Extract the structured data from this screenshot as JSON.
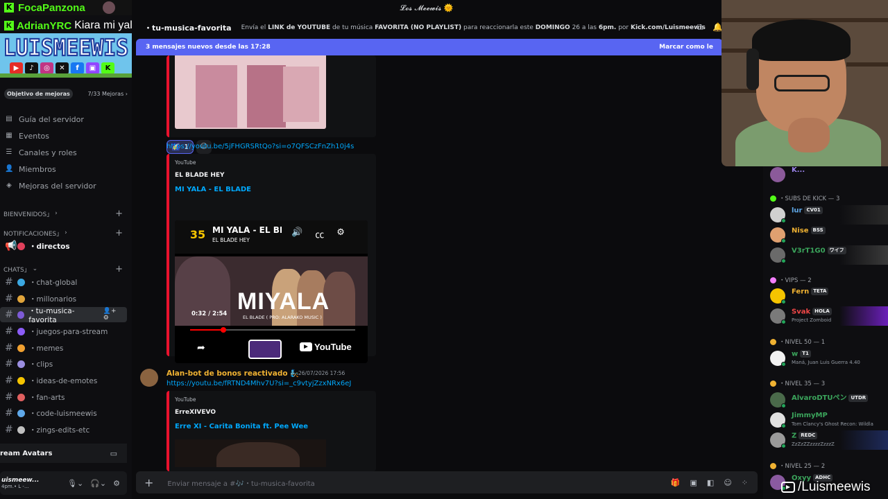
{
  "window": {
    "title": "𝓛𝓸𝓼 𝓜𝓮𝓮𝔀𝓲𝓼 🌞"
  },
  "overlay": {
    "kick_user": "FocaPanzona",
    "chat_user": "AdrianYRC",
    "chat_message": "Kiara mi yala",
    "banner_title": "LUISMEEWIS",
    "watermark": "/Luismeewis"
  },
  "server": {
    "boost_label": "Objetivo de mejoras",
    "boost_count": "7/33 Mejoras ›",
    "nav": [
      {
        "label": "Guía del servidor",
        "icon": "guide-icon"
      },
      {
        "label": "Eventos",
        "icon": "calendar-icon"
      },
      {
        "label": "Canales y roles",
        "icon": "channels-icon"
      },
      {
        "label": "Miembros",
        "icon": "members-icon"
      },
      {
        "label": "Mejoras del servidor",
        "icon": "boost-icon"
      }
    ],
    "categories": {
      "bienvenidos": "BIENVENIDOS」",
      "notificaciones": "NOTIFICACIONES」",
      "chats": "CHATS」"
    },
    "announce_channel": "・directos",
    "channels": [
      {
        "name": "・chat-global",
        "color": "#3ba7e0"
      },
      {
        "name": "・millonarios",
        "color": "#e0a43b"
      },
      {
        "name": "・tu-musica-favorita",
        "color": "#7d5bd6"
      },
      {
        "name": "・juegos-para-stream",
        "color": "#8b5cf6"
      },
      {
        "name": "・memes",
        "color": "#f0a030"
      },
      {
        "name": "・clips",
        "color": "#9b8ee0"
      },
      {
        "name": "・ideas-de-emotes",
        "color": "#f5c400"
      },
      {
        "name": "・fan-arts",
        "color": "#e06060"
      },
      {
        "name": "・code-luismeewis",
        "color": "#5fa8e8"
      },
      {
        "name": "・zings-edits-etc",
        "color": "#c0c0c0"
      }
    ],
    "voice_channel": "ream Avatars",
    "user_name": "uismeew...",
    "user_status": "4pm.• L -..."
  },
  "header": {
    "channel": "・tu-musica-favorita",
    "topic_pre": "Envía el ",
    "topic_b1": "LINK de YOUTUBE",
    "topic_mid1": " de tu música ",
    "topic_b2": "FAVORITA (NO PLAYLIST)",
    "topic_mid2": " para reaccionarla este ",
    "topic_b3": "DOMINGO",
    "topic_mid3": " 26 a las ",
    "topic_b4": "6pm.",
    "topic_mid4": " por ",
    "topic_b5": "Kick.com/Luismeewis"
  },
  "new_messages": {
    "text": "3 mensajes nuevos desde las 17:28",
    "action": "Marcar como le"
  },
  "messages": {
    "reaction_count": "1",
    "link1": "https://youtu.be/5jFHGRSRtQo?si=o7QFSCzFnZh10j4s",
    "embed1": {
      "provider": "YouTube",
      "author": "EL BLADE HEY",
      "title": "MI YALA - EL BLADE",
      "video_title": "MI YALA - EL BLA",
      "video_channel": "EL BLADE HEY",
      "overlay_text": "MIYALA",
      "credit": "EL BLADE ( PRO: ALARAKO MUSIC )",
      "time": "0:32 / 2:54",
      "progress": 0.2,
      "yt_label": "YouTube"
    },
    "msg2": {
      "author": "Alan-bot de bonos reactivado 🧞",
      "time": "26/07/2026 17:56",
      "link": "https://youtu.be/fRTND4Mhv7U?si=_c9vtyjZzxNRx6eJ",
      "provider": "YouTube",
      "embed_author": "ErreXIVEVO",
      "embed_title": "Erre XI - Carita Bonita ft. Pee Wee"
    }
  },
  "composer": {
    "placeholder": "Enviar mensaje a #🎶・tu-musica-favorita"
  },
  "members": {
    "top_name": "K...",
    "groups": [
      {
        "header": "・SUBS DE KICK — 3"
      },
      {
        "header": "・VIPS — 2"
      },
      {
        "header": "・NIVEL 50 — 1"
      },
      {
        "header": "・NIVEL 35 — 3"
      },
      {
        "header": "・NIVEL 25 — 2"
      }
    ],
    "list": [
      {
        "name": "lur",
        "tag": "CV01",
        "color": "#5fa8e8",
        "act": ""
      },
      {
        "name": "Nise",
        "tag": "BSS",
        "color": "#f0b232",
        "act": ""
      },
      {
        "name": "V3rT1G0",
        "tag": "ワイフ",
        "color": "#3ba55c",
        "act": ""
      },
      {
        "name": "Fern",
        "tag": "TETA",
        "color": "#f0b232",
        "act": ""
      },
      {
        "name": "Svak",
        "tag": "HOLA",
        "color": "#f04747",
        "act": "Project Zomboid"
      },
      {
        "name": "w",
        "tag": "T1",
        "color": "#3ba55c",
        "act": "Maná, Juan Luis Guerra 4.40"
      },
      {
        "name": "AlvaroDTUペン",
        "tag": "UTDR",
        "color": "#3ba55c",
        "act": ""
      },
      {
        "name": "JimmyMP",
        "tag": "",
        "color": "#3ba55c",
        "act": "Tom Clancy's Ghost Recon: Wildla"
      },
      {
        "name": "Z",
        "tag": "REDC",
        "color": "#3ba55c",
        "act": "ZzZzZZzzzzZzzzZ"
      },
      {
        "name": "Oxyy",
        "tag": "ADHC",
        "color": "#3ba55c",
        "act": ""
      }
    ]
  }
}
